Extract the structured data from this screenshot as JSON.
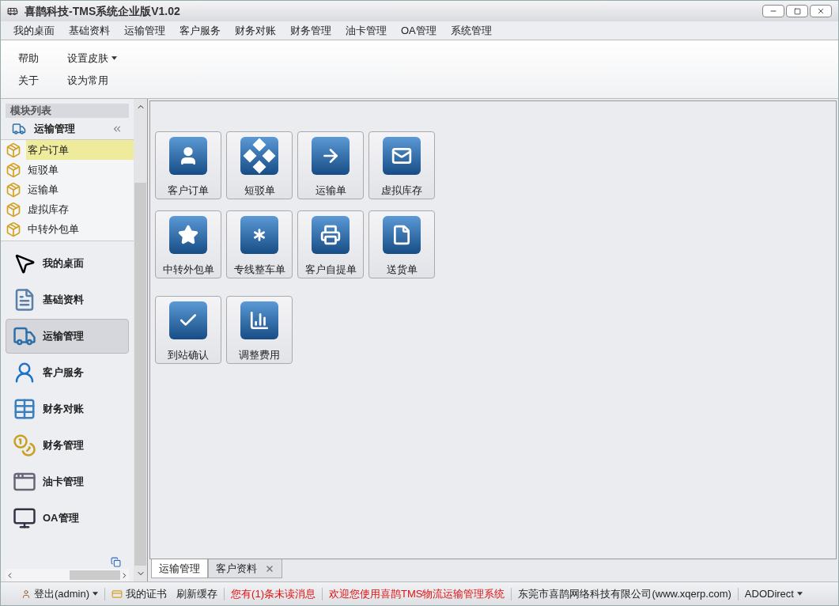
{
  "window": {
    "title": "喜鹊科技-TMS系统企业版V1.02"
  },
  "menu": [
    {
      "label": "我的桌面",
      "selected": false
    },
    {
      "label": "基础资料",
      "selected": false
    },
    {
      "label": "运输管理",
      "selected": false
    },
    {
      "label": "客户服务",
      "selected": false
    },
    {
      "label": "财务对账",
      "selected": false
    },
    {
      "label": "财务管理",
      "selected": false
    },
    {
      "label": "油卡管理",
      "selected": false
    },
    {
      "label": "OA管理",
      "selected": false
    },
    {
      "label": "系统管理",
      "selected": false
    }
  ],
  "ribbon": {
    "rows": [
      [
        {
          "label": "帮助",
          "dropdown": false
        },
        {
          "label": "设置皮肤",
          "dropdown": true
        }
      ],
      [
        {
          "label": "关于",
          "dropdown": false
        },
        {
          "label": "设为常用",
          "dropdown": false
        }
      ]
    ]
  },
  "sidebar": {
    "header": "模块列表",
    "group_title": "运输管理",
    "items": [
      {
        "label": "客户订单",
        "selected": true
      },
      {
        "label": "短驳单",
        "selected": false
      },
      {
        "label": "运输单",
        "selected": false
      },
      {
        "label": "虚拟库存",
        "selected": false
      },
      {
        "label": "中转外包单",
        "selected": false
      }
    ],
    "nav": [
      {
        "label": "我的桌面",
        "selected": false
      },
      {
        "label": "基础资料",
        "selected": false
      },
      {
        "label": "运输管理",
        "selected": true
      },
      {
        "label": "客户服务",
        "selected": false
      },
      {
        "label": "财务对账",
        "selected": false
      },
      {
        "label": "财务管理",
        "selected": false
      },
      {
        "label": "油卡管理",
        "selected": false
      },
      {
        "label": "OA管理",
        "selected": false
      }
    ]
  },
  "tiles": [
    [
      "客户订单",
      "短驳单",
      "运输单",
      "虚拟库存"
    ],
    [
      "中转外包单",
      "专线整车单",
      "客户自提单",
      "送货单"
    ],
    [
      "到站确认",
      "调整费用"
    ]
  ],
  "doc_tabs": [
    {
      "label": "运输管理",
      "selected": true,
      "closable": false
    },
    {
      "label": "客户资料",
      "selected": false,
      "closable": true
    }
  ],
  "status_bar": [
    {
      "label": "登出(admin)",
      "kind": "user"
    },
    {
      "label": "我的证书",
      "kind": "cert"
    },
    {
      "label": "刷新缓存",
      "kind": "plain"
    },
    {
      "label": "您有(1)条未读消息",
      "kind": "alert"
    },
    {
      "label": "欢迎您使用喜鹊TMS物流运输管理系统",
      "kind": "alert"
    },
    {
      "label": "东莞市喜鹊网络科技有限公司(www.xqerp.com)",
      "kind": "plain"
    },
    {
      "label": "ADODirect",
      "kind": "dropdown"
    }
  ]
}
